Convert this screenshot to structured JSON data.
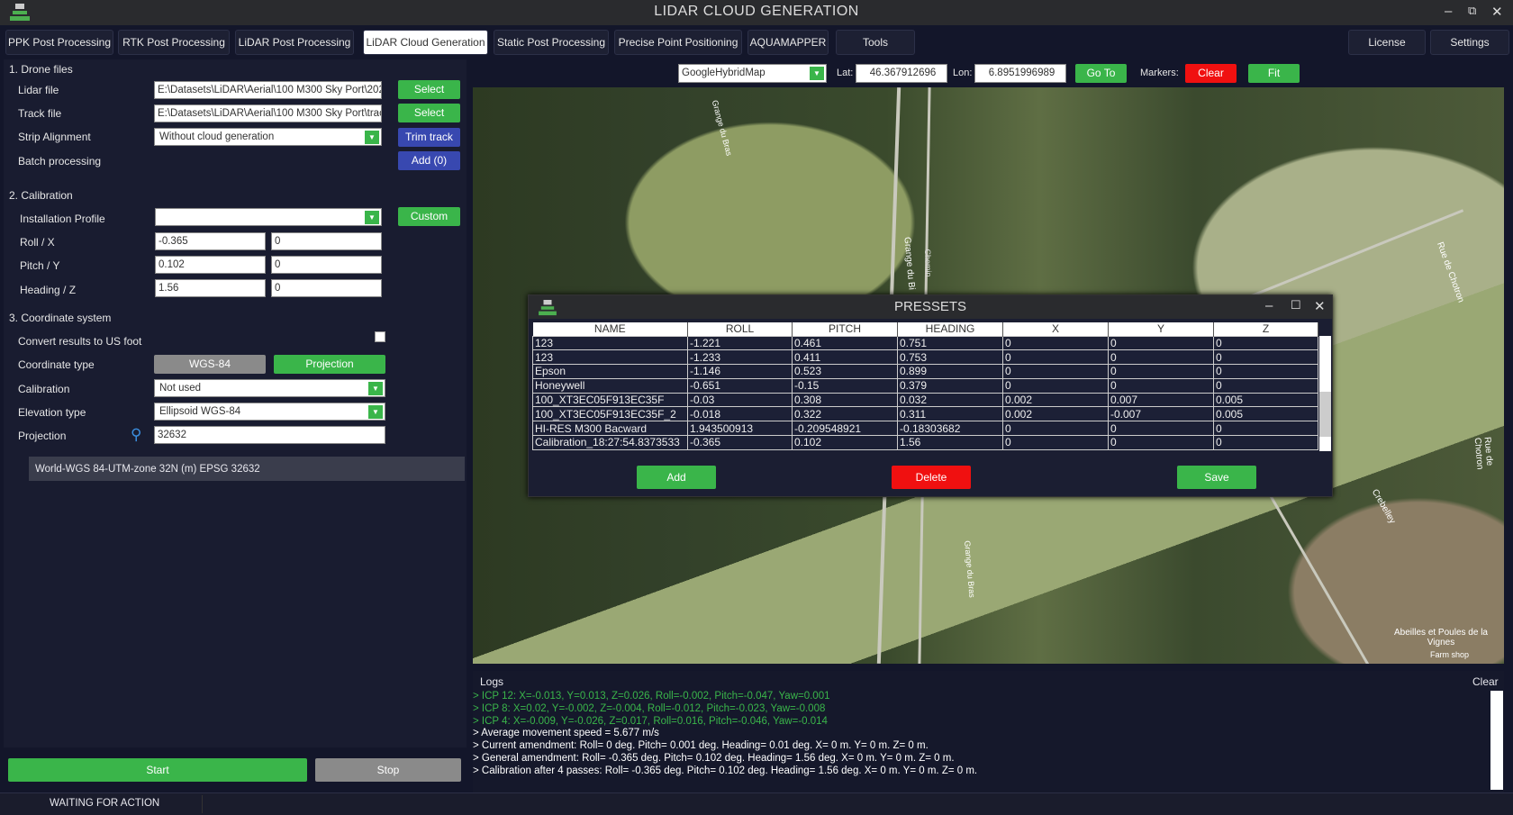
{
  "window": {
    "title": "LIDAR CLOUD GENERATION"
  },
  "tabs": [
    {
      "label": "PPK Post Processing"
    },
    {
      "label": "RTK Post Processing"
    },
    {
      "label": "LiDAR Post Processing"
    },
    {
      "label": "LiDAR Cloud Generation",
      "active": true
    },
    {
      "label": "Static Post Processing"
    },
    {
      "label": "Precise Point Positioning"
    },
    {
      "label": "AQUAMAPPER"
    },
    {
      "label": "Tools"
    }
  ],
  "right_tabs": {
    "license": "License",
    "settings": "Settings"
  },
  "drone_files": {
    "title": "1. Drone files",
    "lidar_label": "Lidar file",
    "lidar_value": "E:\\Datasets\\LiDAR\\Aerial\\100 M300 Sky Port\\202",
    "track_label": "Track file",
    "track_value": "E:\\Datasets\\LiDAR\\Aerial\\100 M300 Sky Port\\trac",
    "select": "Select",
    "strip_label": "Strip Alignment",
    "strip_value": "Without cloud generation",
    "trim": "Trim track",
    "batch_label": "Batch processing",
    "add": "Add (0)"
  },
  "calibration": {
    "title": "2. Calibration",
    "profile_label": "Installation Profile",
    "profile_value": "",
    "custom": "Custom",
    "roll_label": "Roll / X",
    "roll": "-0.365",
    "x": "0",
    "pitch_label": "Pitch / Y",
    "pitch": "0.102",
    "y": "0",
    "heading_label": "Heading / Z",
    "heading": "1.56",
    "z": "0"
  },
  "coords": {
    "title": "3. Coordinate system",
    "usfoot_label": "Convert results to US foot",
    "usfoot_checked": false,
    "type_label": "Coordinate type",
    "wgs": "WGS-84",
    "projection_btn": "Projection",
    "cal_label": "Calibration",
    "cal_value": "Not used",
    "elev_label": "Elevation type",
    "elev_value": "Ellipsoid WGS-84",
    "proj_label": "Projection",
    "proj_value": "32632",
    "proj_result": "World-WGS 84-UTM-zone 32N (m) EPSG 32632"
  },
  "actions": {
    "start": "Start",
    "stop": "Stop"
  },
  "status": "WAITING FOR ACTION",
  "map": {
    "provider": "GoogleHybridMap",
    "lat_label": "Lat:",
    "lat": "46.367912696",
    "lon_label": "Lon:",
    "lon": "6.8951996989",
    "goto": "Go To",
    "markers_label": "Markers:",
    "clear": "Clear",
    "fit": "Fit",
    "labels": [
      "Grange du Bras",
      "Grange du Bi",
      "Chemin",
      "Rue de Chotron",
      "Rue de Chotron",
      "Crebelley",
      "Grange du Bras",
      "Abeilles et Poules de la Vignes",
      "Farm shop"
    ]
  },
  "presets": {
    "title": "PRESSETS",
    "columns": [
      "NAME",
      "ROLL",
      "PITCH",
      "HEADING",
      "X",
      "Y",
      "Z"
    ],
    "rows": [
      [
        "123",
        "-1.221",
        "0.461",
        "0.751",
        "0",
        "0",
        "0"
      ],
      [
        "123",
        "-1.233",
        "0.411",
        "0.753",
        "0",
        "0",
        "0"
      ],
      [
        "Epson",
        "-1.146",
        "0.523",
        "0.899",
        "0",
        "0",
        "0"
      ],
      [
        "Honeywell",
        "-0.651",
        "-0.15",
        "0.379",
        "0",
        "0",
        "0"
      ],
      [
        "100_XT3EC05F913EC35F",
        "-0.03",
        "0.308",
        "0.032",
        "0.002",
        "0.007",
        "0.005"
      ],
      [
        "100_XT3EC05F913EC35F_2",
        "-0.018",
        "0.322",
        "0.311",
        "0.002",
        "-0.007",
        "0.005"
      ],
      [
        "HI-RES M300 Bacward",
        "1.943500913",
        "-0.209548921",
        "-0.18303682",
        "0",
        "0",
        "0"
      ],
      [
        "Calibration_18:27:54.8373533",
        "-0.365",
        "0.102",
        "1.56",
        "0",
        "0",
        "0"
      ]
    ],
    "add": "Add",
    "delete": "Delete",
    "save": "Save"
  },
  "logs": {
    "title": "Logs",
    "clear": "Clear",
    "lines": [
      {
        "text": "> ICP 12: X=-0.013, Y=0.013, Z=0.026, Roll=-0.002, Pitch=-0.047, Yaw=0.001",
        "color": "#3ab54a"
      },
      {
        "text": "> ICP 8: X=0.02, Y=-0.002, Z=-0.004, Roll=-0.012, Pitch=-0.023, Yaw=-0.008",
        "color": "#3ab54a"
      },
      {
        "text": "> ICP 4: X=-0.009, Y=-0.026, Z=0.017, Roll=0.016, Pitch=-0.046, Yaw=-0.014",
        "color": "#3ab54a"
      },
      {
        "text": "> Average movement speed = 5.677 m/s",
        "color": "#ffffff"
      },
      {
        "text": "> Current amendment: Roll= 0 deg. Pitch= 0.001 deg. Heading= 0.01 deg. X= 0 m. Y= 0 m. Z= 0 m.",
        "color": "#ffffff"
      },
      {
        "text": "> General amendment: Roll= -0.365 deg. Pitch= 0.102 deg. Heading= 1.56 deg. X= 0 m. Y= 0 m. Z= 0 m.",
        "color": "#ffffff"
      },
      {
        "text": "> Calibration after 4 passes: Roll= -0.365 deg. Pitch= 0.102 deg. Heading= 1.56 deg. X= 0 m. Y= 0 m. Z= 0 m.",
        "color": "#ffffff"
      }
    ]
  }
}
